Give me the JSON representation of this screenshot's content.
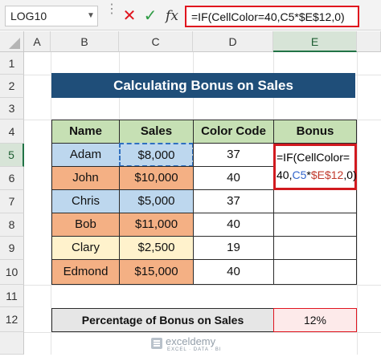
{
  "formula_bar": {
    "name_box": "LOG10",
    "cancel_icon": "✕",
    "enter_icon": "✓",
    "fx_label": "fx",
    "formula": "=IF(CellColor=40,C5*$E$12,0)"
  },
  "columns": [
    "A",
    "B",
    "C",
    "D",
    "E"
  ],
  "rows": [
    "1",
    "2",
    "3",
    "4",
    "5",
    "6",
    "7",
    "8",
    "9",
    "10",
    "11",
    "12"
  ],
  "title": "Calculating Bonus on Sales",
  "table": {
    "headers": [
      "Name",
      "Sales",
      "Color Code",
      "Bonus"
    ],
    "rows": [
      {
        "name": "Adam",
        "sales": "$8,000",
        "code": "37",
        "bonus": "",
        "color": "#bdd7ee"
      },
      {
        "name": "John",
        "sales": "$10,000",
        "code": "40",
        "bonus": "",
        "color": "#f4b084"
      },
      {
        "name": "Chris",
        "sales": "$5,000",
        "code": "37",
        "bonus": "",
        "color": "#bdd7ee"
      },
      {
        "name": "Bob",
        "sales": "$11,000",
        "code": "40",
        "bonus": "",
        "color": "#f4b084"
      },
      {
        "name": "Clary",
        "sales": "$2,500",
        "code": "19",
        "bonus": "",
        "color": "#fff2cc"
      },
      {
        "name": "Edmond",
        "sales": "$15,000",
        "code": "40",
        "bonus": "",
        "color": "#f4b084"
      }
    ]
  },
  "editing_cell": {
    "line1": "=IF(CellColor=",
    "line2_a": "40,",
    "line2_ref1": "C5",
    "line2_b": "*",
    "line2_ref2": "$E$12",
    "line2_c": ",0)"
  },
  "percentage": {
    "label": "Percentage of Bonus on Sales",
    "value": "12%"
  },
  "watermark": {
    "name": "exceldemy",
    "tagline": "EXCEL · DATA · BI"
  },
  "colors": {
    "title_bg": "#1f4e79",
    "header_bg": "#c6e0b4",
    "highlight_red": "#e0141e",
    "selection_green": "#217346"
  }
}
